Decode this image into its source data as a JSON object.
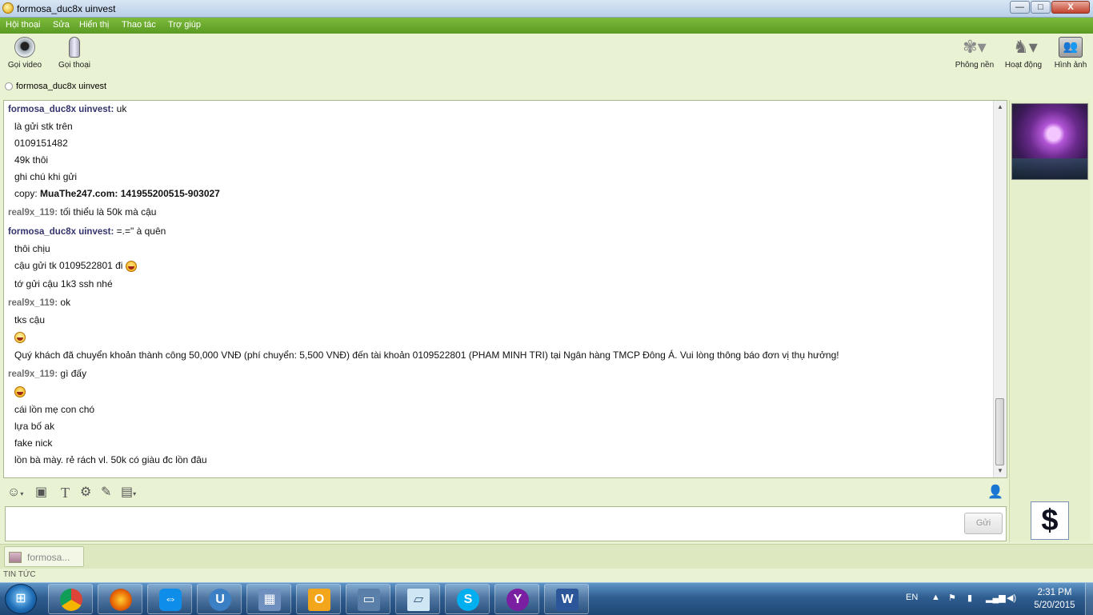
{
  "window": {
    "title": "formosa_duc8x uinvest",
    "minimize": "—",
    "maximize": "□",
    "close": "X"
  },
  "menu": [
    "Hội thoại",
    "Sửa",
    "Hiển thị",
    "Thao tác",
    "Trợ giúp"
  ],
  "toolbar": {
    "video_call": "Gọi video",
    "voice_call": "Gọi thoại",
    "background": "Phông nền",
    "activities": "Hoạt động",
    "images": "Hình ảnh"
  },
  "contact": {
    "name": "formosa_duc8x uinvest"
  },
  "messages": [
    {
      "sender": "formosa_duc8x uinvest:",
      "text": "uk"
    },
    {
      "text": "là gửi stk trên"
    },
    {
      "text": "0109151482"
    },
    {
      "text": "49k thôi"
    },
    {
      "text": "ghi chú khi gửi"
    },
    {
      "text": "copy: ",
      "bold": "MuaThe247.com: 141955200515-903027"
    },
    {
      "sender": "real9x_119:",
      "text": "tối thiểu là 50k mà cậu"
    },
    {
      "sender": "formosa_duc8x uinvest:",
      "text": "=.=\" à quên"
    },
    {
      "text": "thôi chịu"
    },
    {
      "text": "cậu gửi tk 0109522801 đi"
    },
    {
      "text": "tớ gửi cậu 1k3 ssh nhé"
    },
    {
      "sender": "real9x_119:",
      "text": "ok"
    },
    {
      "text": "tks cậu"
    },
    {
      "text": ""
    },
    {
      "text": "Quý khách đã chuyển khoản thành công 50,000 VNĐ (phí chuyển: 5,500 VNĐ) đến tài khoản 0109522801 (PHAM MINH TRI) tại Ngân hàng TMCP Đông Á. Vui lòng thông báo đơn vị thụ hưởng!"
    },
    {
      "sender": "real9x_119:",
      "text": "gì đấy"
    },
    {
      "text": ""
    },
    {
      "text": "cái lồn mẹ con chó"
    },
    {
      "text": "lựa bố ak"
    },
    {
      "text": "fake nick"
    },
    {
      "text": "lồn bà mày. rẻ rách vl. 50k có giàu đc lồn đâu"
    }
  ],
  "input": {
    "value": "",
    "send_label": "Gửi"
  },
  "tab": {
    "label": "formosa..."
  },
  "news_label": "TIN TỨC",
  "sidebar": {
    "avatar2_glyph": "$"
  },
  "taskbar": {
    "apps": [
      "chrome-icon",
      "firefox-icon",
      "teamviewer-icon",
      "ultraviewer-icon",
      "network-icon",
      "outlook-icon",
      "remote-desktop-icon",
      "notepad-icon",
      "skype-icon",
      "yahoo-messenger-icon",
      "word-icon"
    ],
    "language": "EN",
    "time": "2:31 PM",
    "date": "5/20/2015"
  },
  "colors": {
    "menu_green": "#6aab2e",
    "sender_a": "#34346e",
    "sender_b": "#6f6f6f",
    "taskbar": "#2f5d90"
  }
}
